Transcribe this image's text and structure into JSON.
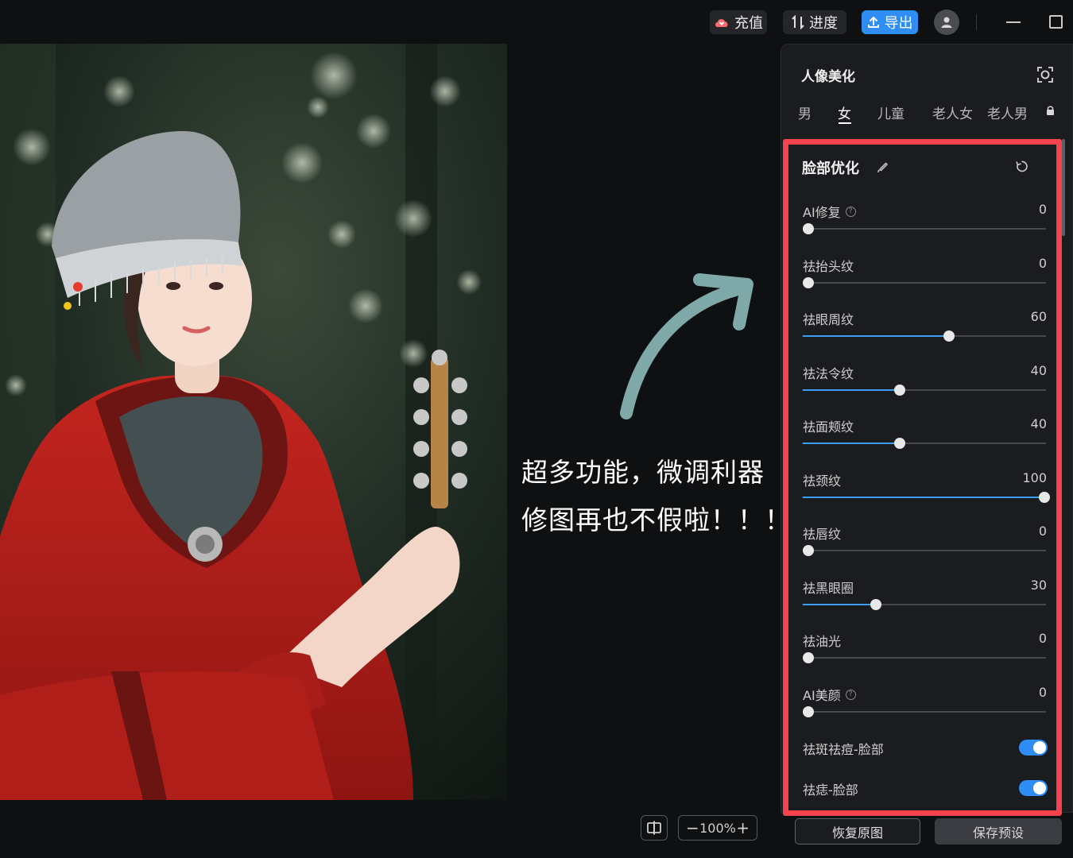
{
  "topbar": {
    "recharge_label": "充值",
    "progress_label": "进度",
    "export_label": "导出"
  },
  "caption": {
    "line1": "超多功能，微调利器",
    "line2": "修图再也不假啦！！！"
  },
  "zoom": {
    "minus": "−",
    "level": "100%",
    "plus": "+"
  },
  "panel": {
    "title": "人像美化",
    "tabs": [
      {
        "label": "男"
      },
      {
        "label": "女",
        "active": true
      },
      {
        "label": "儿童"
      },
      {
        "label": "老人女"
      },
      {
        "label": "老人男"
      }
    ],
    "section_title": "脸部优化",
    "sliders": [
      {
        "label": "AI修复",
        "value": "0",
        "percent": 0,
        "help": true
      },
      {
        "label": "祛抬头纹",
        "value": "0",
        "percent": 0
      },
      {
        "label": "祛眼周纹",
        "value": "60",
        "percent": 60
      },
      {
        "label": "祛法令纹",
        "value": "40",
        "percent": 40
      },
      {
        "label": "祛面颊纹",
        "value": "40",
        "percent": 40
      },
      {
        "label": "祛颈纹",
        "value": "100",
        "percent": 100
      },
      {
        "label": "祛唇纹",
        "value": "0",
        "percent": 0
      },
      {
        "label": "祛黑眼圈",
        "value": "30",
        "percent": 30
      },
      {
        "label": "祛油光",
        "value": "0",
        "percent": 0
      },
      {
        "label": "AI美颜",
        "value": "0",
        "percent": 0,
        "help": true
      }
    ],
    "toggles": [
      {
        "label": "祛斑祛痘-脸部",
        "on": true
      },
      {
        "label": "祛痣-脸部",
        "on": true
      }
    ],
    "restore_label": "恢复原图",
    "save_preset_label": "保存预设"
  },
  "colors": {
    "accent": "#2f8ef6",
    "highlight_border": "#f4434f",
    "arrow": "#7fa9a9"
  }
}
